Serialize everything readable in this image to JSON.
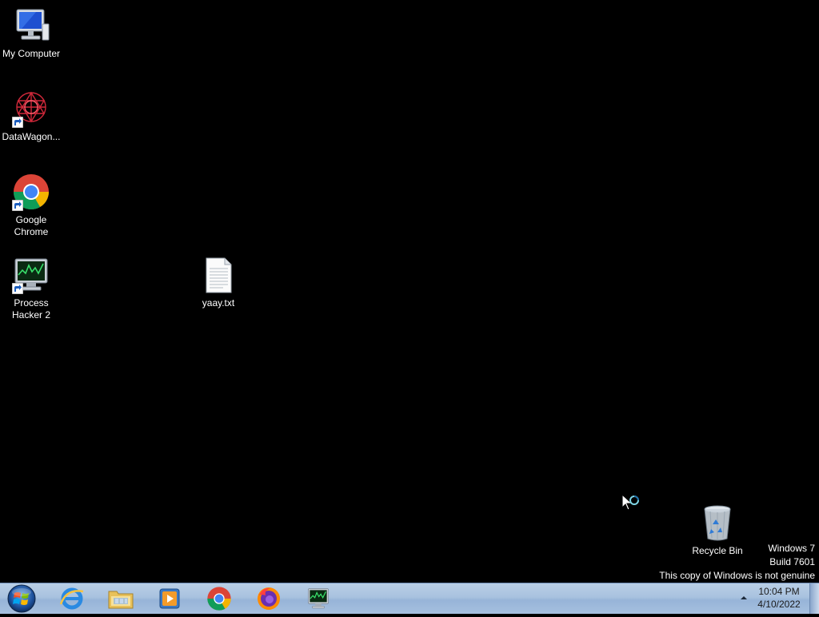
{
  "desktop": {
    "background_color": "#000000",
    "icons": [
      {
        "label": "My Computer",
        "icon": "computer-icon",
        "shortcut": false
      },
      {
        "label": "DataWagon...",
        "icon": "datawagon-icon",
        "shortcut": true
      },
      {
        "label": "Google\nChrome",
        "icon": "chrome-icon",
        "shortcut": true
      },
      {
        "label": "Process\nHacker 2",
        "icon": "process-hacker-icon",
        "shortcut": true
      },
      {
        "label": "yaay.txt",
        "icon": "text-file-icon",
        "shortcut": false
      },
      {
        "label": "Recycle Bin",
        "icon": "recycle-bin-icon",
        "shortcut": false
      }
    ],
    "watermark": {
      "line1": "Windows 7",
      "line2": "Build 7601",
      "line3": "This copy of Windows is not genuine"
    }
  },
  "taskbar": {
    "start_icon": "windows-logo-icon",
    "pinned": [
      {
        "name": "Internet Explorer",
        "icon": "internet-explorer-icon"
      },
      {
        "name": "Windows Explorer",
        "icon": "folder-icon"
      },
      {
        "name": "Windows Media Player",
        "icon": "media-player-icon"
      },
      {
        "name": "Google Chrome",
        "icon": "chrome-icon"
      },
      {
        "name": "Firefox",
        "icon": "firefox-icon"
      },
      {
        "name": "Process Hacker 2",
        "icon": "process-hacker-icon"
      }
    ],
    "clock": {
      "time": "10:04 PM",
      "date": "4/10/2022"
    }
  }
}
